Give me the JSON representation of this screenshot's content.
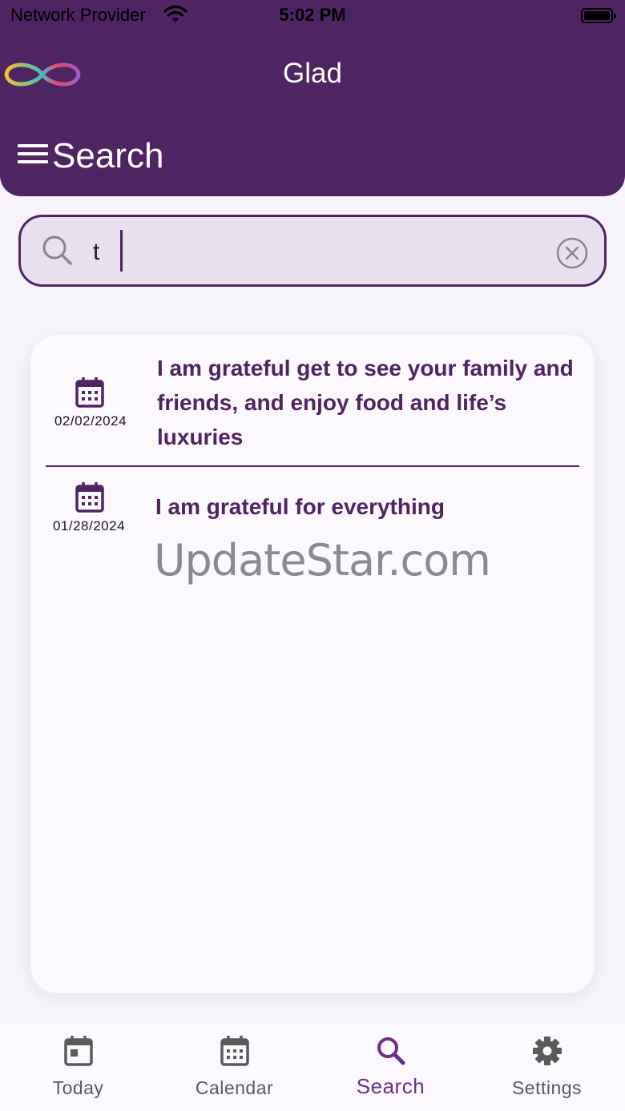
{
  "status_bar": {
    "carrier": "Network Provider",
    "time": "5:02 PM"
  },
  "header": {
    "app_title": "Glad",
    "page_title": "Search",
    "background_color": "#4f2463"
  },
  "search": {
    "value": "t",
    "icon": "search-icon",
    "clear_icon": "clear-circle-icon"
  },
  "results": [
    {
      "date": "02/02/2024",
      "text": "I am grateful get to see your family and friends, and enjoy food and life’s luxuries"
    },
    {
      "date": "01/28/2024",
      "text": "I am grateful for everything"
    }
  ],
  "watermark": "UpdateStar.com",
  "tabs": [
    {
      "label": "Today",
      "icon": "today-icon",
      "active": false
    },
    {
      "label": "Calendar",
      "icon": "calendar-icon",
      "active": false
    },
    {
      "label": "Search",
      "icon": "search-icon",
      "active": true
    },
    {
      "label": "Settings",
      "icon": "gear-icon",
      "active": false
    }
  ],
  "colors": {
    "accent": "#4f2463",
    "active_tab": "#6a2f87",
    "inactive_tab": "#5a5a5a"
  }
}
